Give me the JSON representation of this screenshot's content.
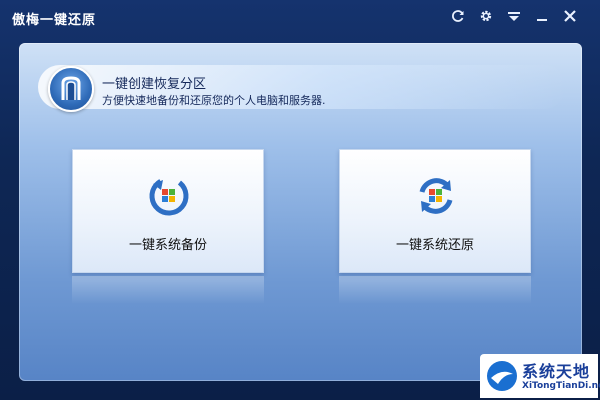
{
  "window": {
    "title": "傲梅一键还原"
  },
  "titlebar": {
    "buttons": [
      {
        "name": "refresh-icon"
      },
      {
        "name": "gear-icon"
      },
      {
        "name": "menu-icon"
      },
      {
        "name": "minimize-icon"
      },
      {
        "name": "close-icon"
      }
    ]
  },
  "header": {
    "title": "一键创建恢复分区",
    "subtitle": "方便快速地备份和还原您的个人电脑和服务器."
  },
  "cards": {
    "backup": {
      "label": "一键系统备份",
      "icon": "backup-icon"
    },
    "restore": {
      "label": "一键系统还原",
      "icon": "restore-icon"
    }
  },
  "watermark": {
    "main": "系统天地",
    "sub": "XiTongTianDi.net"
  },
  "colors": {
    "frame": "#0e2755",
    "panel_top": "#cfe1f6",
    "panel_bottom": "#5784c6",
    "text_dark": "#14285a",
    "watermark_blue": "#1a3f9a"
  }
}
